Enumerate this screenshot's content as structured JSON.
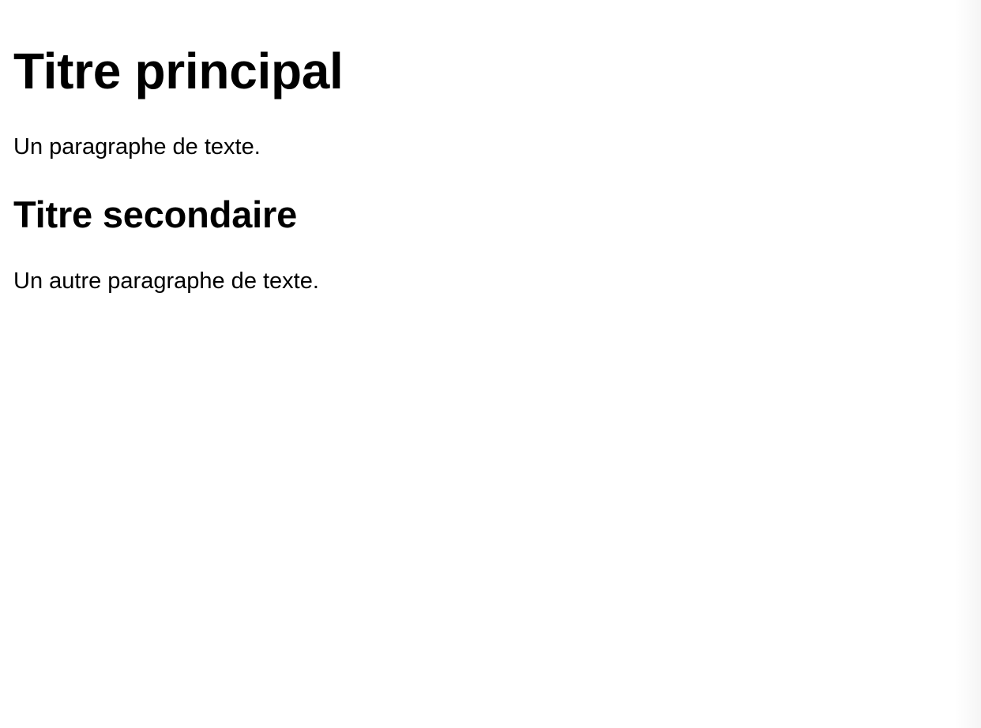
{
  "document": {
    "heading1": "Titre principal",
    "paragraph1": "Un paragraphe de texte.",
    "heading2": "Titre secondaire",
    "paragraph2": "Un autre paragraphe de texte."
  },
  "colors": {
    "background": "#ffffff",
    "text": "#000000"
  }
}
